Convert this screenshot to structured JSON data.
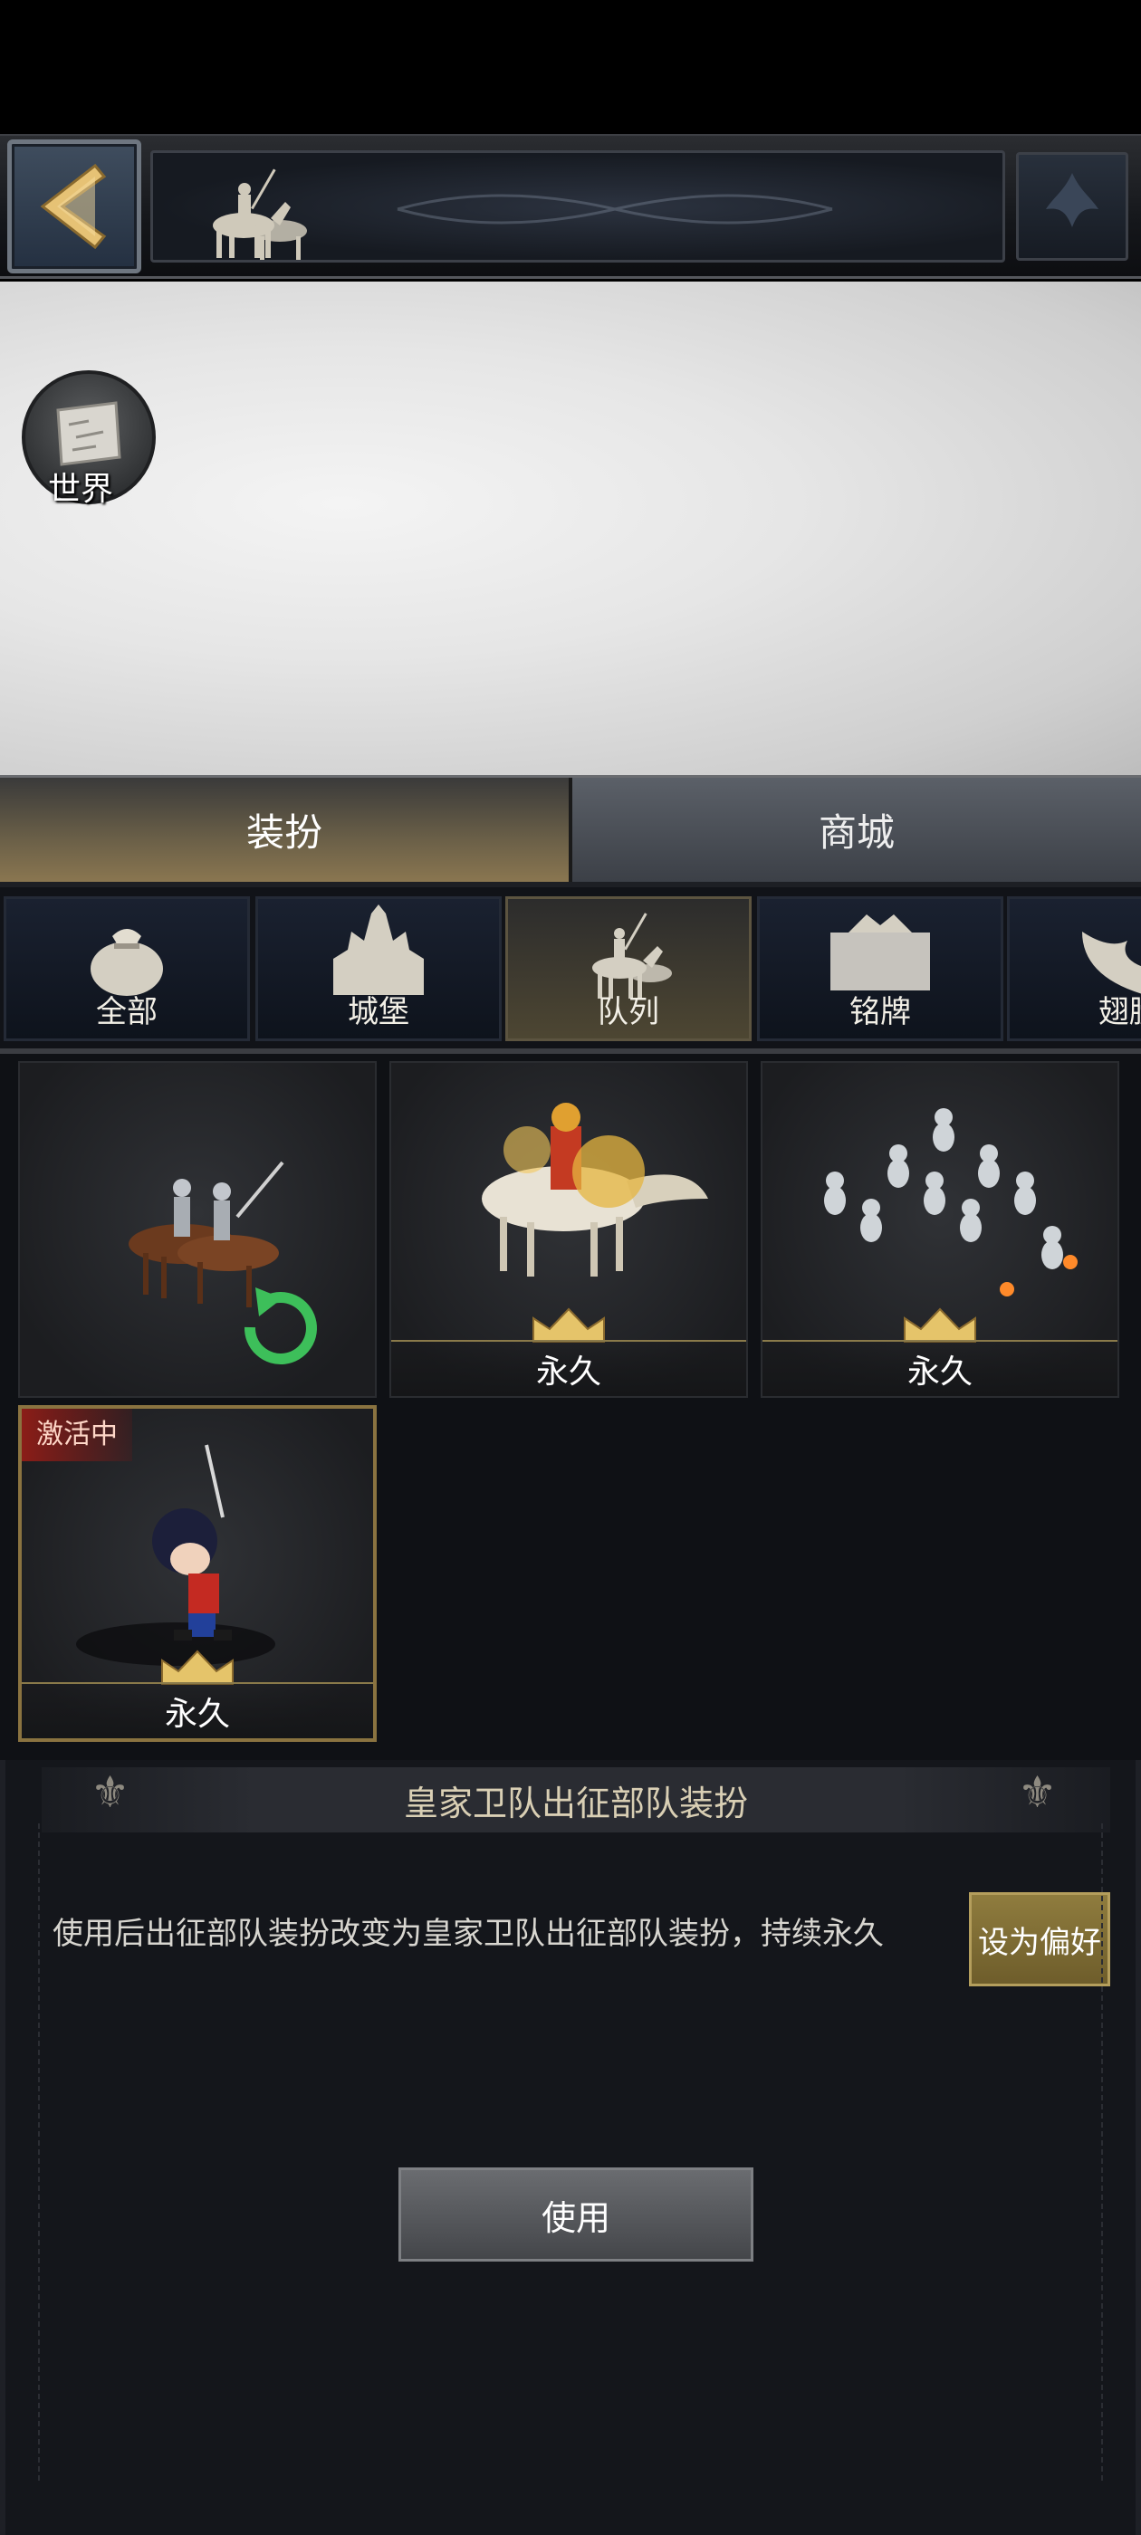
{
  "preview": {
    "world_label": "世界"
  },
  "main_tabs": [
    {
      "label": "装扮",
      "active": true
    },
    {
      "label": "商城",
      "active": false
    }
  ],
  "categories": [
    {
      "label": "全部",
      "icon": "pouch-icon"
    },
    {
      "label": "城堡",
      "icon": "castle-icon"
    },
    {
      "label": "队列",
      "icon": "cavalry-icon",
      "active": true
    },
    {
      "label": "铭牌",
      "icon": "nameplate-icon"
    },
    {
      "label": "翅膀",
      "icon": "wings-icon"
    }
  ],
  "items": [
    {
      "foot": "",
      "icon": "refresh-icon"
    },
    {
      "foot": "永久"
    },
    {
      "foot": "永久"
    },
    {
      "foot": "永久",
      "badge": "激活中",
      "selected": true
    }
  ],
  "detail": {
    "title": "皇家卫队出征部队装扮",
    "description": "使用后出征部队装扮改变为皇家卫队出征部队装扮，持续永久",
    "preference_button": "设为偏好",
    "use_button": "使用"
  },
  "colors": {
    "gold": "#8a7340",
    "active_badge": "#8b1d18",
    "accent_green": "#3dbf5a"
  }
}
